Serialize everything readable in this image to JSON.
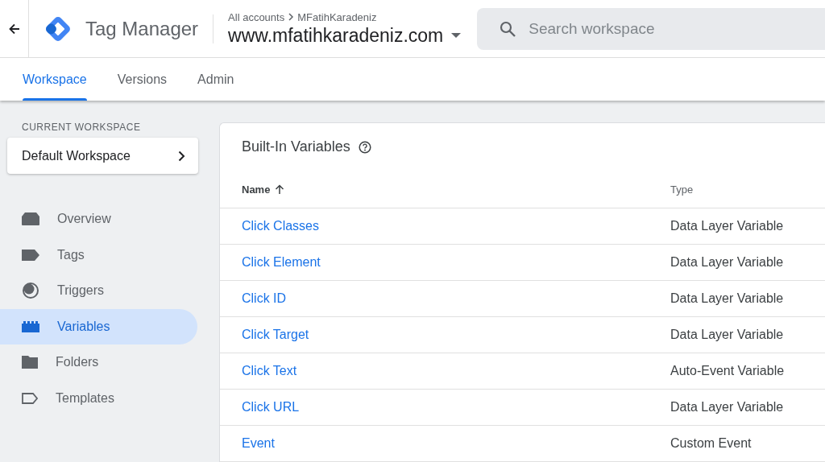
{
  "header": {
    "product": "Tag Manager",
    "breadcrumb": {
      "parent": "All accounts",
      "account": "MFatihKaradeniz"
    },
    "container": "www.mfatihkaradeniz.com",
    "search": {
      "placeholder": "Search workspace"
    }
  },
  "tabs": [
    {
      "label": "Workspace",
      "selected": true
    },
    {
      "label": "Versions",
      "selected": false
    },
    {
      "label": "Admin",
      "selected": false
    }
  ],
  "sidebar": {
    "section_label": "CURRENT WORKSPACE",
    "workspace": "Default Workspace",
    "items": [
      {
        "label": "Overview",
        "kind": "overview",
        "selected": false
      },
      {
        "label": "Tags",
        "kind": "tags",
        "selected": false
      },
      {
        "label": "Triggers",
        "kind": "triggers",
        "selected": false
      },
      {
        "label": "Variables",
        "kind": "variables",
        "selected": true
      },
      {
        "label": "Folders",
        "kind": "folders",
        "selected": false
      },
      {
        "label": "Templates",
        "kind": "templates",
        "selected": false
      }
    ]
  },
  "card": {
    "title": "Built-In Variables",
    "columns": [
      "Name",
      "Type"
    ],
    "rows": [
      {
        "name": "Click Classes",
        "type": "Data Layer Variable"
      },
      {
        "name": "Click Element",
        "type": "Data Layer Variable"
      },
      {
        "name": "Click ID",
        "type": "Data Layer Variable"
      },
      {
        "name": "Click Target",
        "type": "Data Layer Variable"
      },
      {
        "name": "Click Text",
        "type": "Auto-Event Variable"
      },
      {
        "name": "Click URL",
        "type": "Data Layer Variable"
      },
      {
        "name": "Event",
        "type": "Custom Event"
      }
    ]
  }
}
